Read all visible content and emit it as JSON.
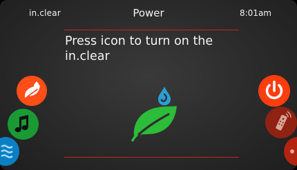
{
  "header": {
    "device_name": "in.clear",
    "screen_title": "Power",
    "time": "8:01am"
  },
  "main": {
    "message": "Press icon to turn on the in.clear",
    "center_icon": "leaf-water-drop-icon"
  },
  "left_buttons": [
    {
      "icon": "leaf-icon",
      "color": "#ff4e17"
    },
    {
      "icon": "music-note-icon",
      "color": "#1a9a34"
    },
    {
      "icon": "water-waves-icon",
      "color": "#0c7fc3"
    }
  ],
  "right_buttons": [
    {
      "icon": "power-icon",
      "color": "#ff3d0f"
    },
    {
      "icon": "remote-control-icon",
      "color": "#8f2212"
    },
    {
      "icon": "more-icon",
      "color": "#b22410"
    }
  ],
  "colors": {
    "divider": "#c8241c",
    "leaf_green": "#2dbb3a",
    "drop_blue": "#2a9fd6",
    "background": "#2e2e2e"
  }
}
